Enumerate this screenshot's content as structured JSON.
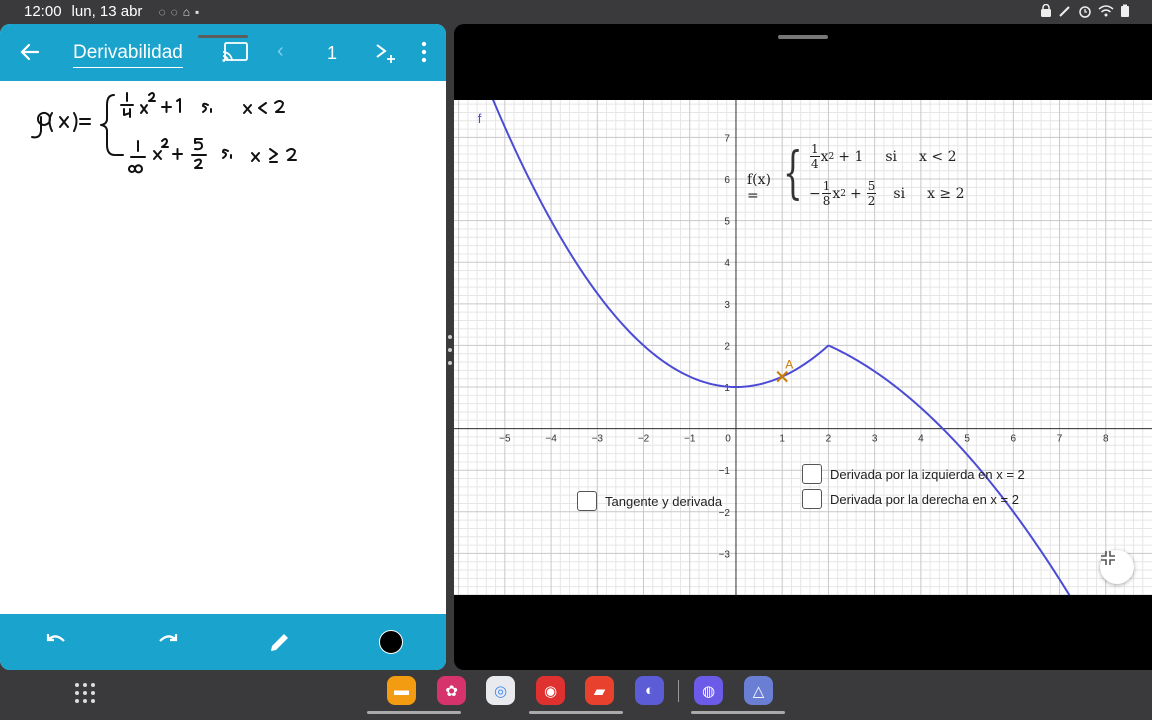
{
  "statusbar": {
    "time": "12:00",
    "date": "lun, 13 abr",
    "left_icons": [
      "◌",
      "◌",
      "⌂",
      "▪"
    ],
    "right_icons": [
      "▣",
      "✎",
      "⏰",
      "wifi",
      "▮"
    ]
  },
  "notes_app": {
    "title": "Derivabilidad",
    "page": "1",
    "prev_symbol": "‹",
    "handwriting": {
      "function_name": "g (x) =",
      "case1_expr": "x² + 1",
      "case1_frac_num": "1",
      "case1_frac_den": "4",
      "case1_cond": "si   x < 2",
      "case2_expr": "x² + 5/2",
      "case2_cond": "si   x ≥ 2"
    },
    "bottom_tools": [
      "undo",
      "redo",
      "pen",
      "color"
    ],
    "pen_color": "#000000"
  },
  "geogebra": {
    "curve_label": "f",
    "point_label": "A",
    "formula": {
      "fx": "f(x) =",
      "case1_frac_num": "1",
      "case1_frac_den": "4",
      "case1_tail": "x",
      "case1_plus": "+ 1",
      "case1_si": "si",
      "case1_cond": "x < 2",
      "case2_sign": "−",
      "case2_frac_num": "1",
      "case2_frac_den": "8",
      "case2_tail": "x",
      "case2_plus": "+",
      "case2_frac2_num": "5",
      "case2_frac2_den": "2",
      "case2_si": "si",
      "case2_cond": "x ≥ 2",
      "sq": "2"
    },
    "checkboxes": {
      "tangent": "Tangente y derivada",
      "left_deriv": "Derivada por la izquierda en x = 2",
      "right_deriv": "Derivada por la derecha en x = 2"
    },
    "x_ticks": [
      "−5",
      "−4",
      "−3",
      "−2",
      "−1",
      "0",
      "1",
      "2",
      "3",
      "4",
      "5",
      "6",
      "7",
      "8"
    ],
    "y_ticks": [
      "7",
      "6",
      "5",
      "4",
      "3",
      "2",
      "1",
      "−1",
      "−2",
      "−3"
    ],
    "curve_color": "#4b4bd6",
    "point_color": "#cc7a00"
  },
  "chart_data": {
    "type": "line",
    "series": [
      {
        "name": "f",
        "domain": [
          -5.5,
          2
        ],
        "formula": "0.25*x^2 + 1"
      },
      {
        "name": "f",
        "domain": [
          2,
          7.3
        ],
        "formula": "-0.125*x^2 + 2.5"
      }
    ],
    "points": [
      {
        "name": "A",
        "x": 1,
        "y": 1.25
      }
    ],
    "xlim": [
      -6.1,
      9
    ],
    "ylim": [
      -4,
      7.9
    ],
    "grid": true
  },
  "dock": {
    "apps": [
      {
        "name": "files",
        "glyph": "▬",
        "color": "#f39c12"
      },
      {
        "name": "gallery",
        "glyph": "✿",
        "color": "#d6336c"
      },
      {
        "name": "chrome",
        "glyph": "◎",
        "color": "#e8eaed"
      },
      {
        "name": "camera",
        "glyph": "◉",
        "color": "#e03131"
      },
      {
        "name": "notes",
        "glyph": "▰",
        "color": "#e8422f"
      },
      {
        "name": "internet",
        "glyph": "◐",
        "color": "#5c5cd6"
      },
      {
        "name": "game",
        "glyph": "◍",
        "color": "#6b5be8"
      },
      {
        "name": "geogebra",
        "glyph": "△",
        "color": "#6a7fd4"
      }
    ]
  }
}
